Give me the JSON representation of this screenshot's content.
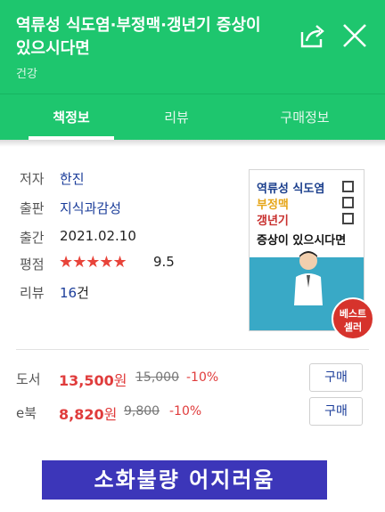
{
  "header": {
    "title_line1": "역류성 식도염·부정맥·갱년기 증상이",
    "title_line2": "있으시다면",
    "category": "건강",
    "share_icon": "share-icon",
    "close_icon": "close-icon"
  },
  "tabs": [
    {
      "label": "책정보",
      "active": true
    },
    {
      "label": "리뷰",
      "active": false
    },
    {
      "label": "구매정보",
      "active": false
    }
  ],
  "book": {
    "author_label": "저자",
    "author": "한진",
    "publisher_label": "출판",
    "publisher": "지식과감성",
    "date_label": "출간",
    "date": "2021.02.10",
    "rating_label": "평점",
    "stars": "★★★★★",
    "rating": "9.5",
    "rating_value": 9.5,
    "review_label": "리뷰",
    "review_count": "16",
    "review_unit": "건"
  },
  "cover": {
    "line1": "역류성 식도염",
    "line2": "부정맥",
    "line3": "갱년기",
    "line4": "증상이 있으시다면",
    "badge_line1": "베스트",
    "badge_line2": "셀러"
  },
  "prices": [
    {
      "label": "도서",
      "price": "13,500",
      "unit": "원",
      "original": "15,000",
      "discount": "-10%",
      "button": "구매"
    },
    {
      "label": "e북",
      "price": "8,820",
      "unit": "원",
      "original": "9,800",
      "discount": "-10%",
      "button": "구매"
    }
  ],
  "banner": {
    "text": "소화불량 어지러움"
  },
  "colors": {
    "brand_green": "#1ec66e",
    "price_red": "#e03c3c",
    "link_blue": "#1b3d9a",
    "banner_blue": "#3c36b9"
  }
}
